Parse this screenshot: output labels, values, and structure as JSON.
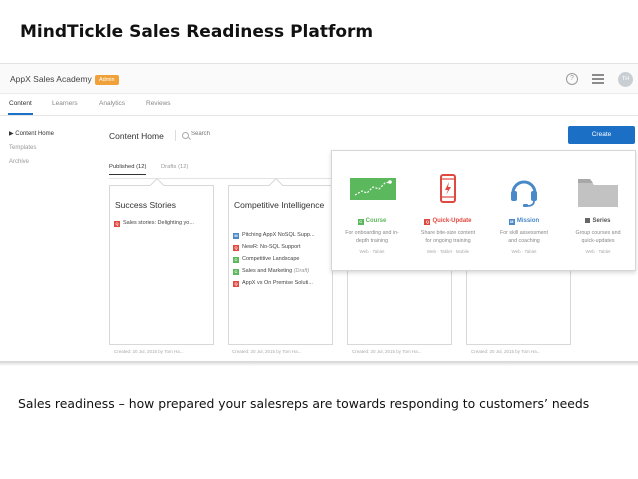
{
  "slide": {
    "title": "MindTickle Sales Readiness Platform",
    "caption": "Sales readiness – how prepared your salesreps are towards responding to customers’ needs"
  },
  "app": {
    "title": "AppX Sales Academy",
    "badge": "Admin",
    "avatar_initials": "TH",
    "icons": {
      "help": "help-circle-icon",
      "menu": "hamburger-menu-icon"
    }
  },
  "nav": {
    "tabs": [
      "Content",
      "Learners",
      "Analytics",
      "Reviews"
    ],
    "active": "Content"
  },
  "sidebar": {
    "items": [
      "▶ Content Home",
      "Templates",
      "Archive"
    ]
  },
  "main": {
    "heading": "Content Home",
    "search_placeholder": "Search",
    "create_label": "Create",
    "subtabs": [
      "Published (12)",
      "Drafts (12)"
    ]
  },
  "cards": [
    {
      "title": "Success Stories",
      "items": [
        {
          "type": "Q",
          "text": "Sales stories: Delighting yo..."
        }
      ],
      "created": "Created: 20 Jul, 2015 by Tom Ha..."
    },
    {
      "title": "Competitive Intelligence",
      "items": [
        {
          "type": "M",
          "text": "Pitching AppX NoSQL Supp..."
        },
        {
          "type": "Q",
          "text": "NewR: No-SQL Support"
        },
        {
          "type": "C",
          "text": "Competitive Landscape"
        },
        {
          "type": "C",
          "text": "Sales and Marketing",
          "suffix": "(Draft)"
        },
        {
          "type": "Q",
          "text": "AppX vs On Premise Soluti..."
        }
      ],
      "created": "Created: 20 Jul, 2015 by Tom Ha..."
    },
    {
      "title": "",
      "items": [],
      "created": "Created: 20 Jul, 2015 by Tom Ha..."
    },
    {
      "title": "",
      "items": [],
      "created": "Created: 20 Jul, 2015 by Tom Ha..."
    }
  ],
  "create_options": [
    {
      "name": "Course",
      "icon_letter": "C",
      "icon": "chart-progress-icon",
      "color": "#5cb85c",
      "desc_lines": [
        "For onboarding and in-",
        "depth training"
      ],
      "platforms": "Web · Tablet"
    },
    {
      "name": "Quick-Update",
      "icon_letter": "Q",
      "icon": "phone-alert-icon",
      "color": "#e0493f",
      "desc_lines": [
        "Share bite-size content",
        "for ongoing training"
      ],
      "platforms": "Web · Tablet · Mobile"
    },
    {
      "name": "Mission",
      "icon_letter": "M",
      "icon": "headset-icon",
      "color": "#4a89c8",
      "desc_lines": [
        "For skill assessment",
        "and coaching"
      ],
      "platforms": "Web · Tablet"
    },
    {
      "name": "Series",
      "icon_letter": "■",
      "icon": "folder-icon",
      "color": "#666666",
      "desc_lines": [
        "Group courses and",
        "quick-updates"
      ],
      "platforms": "Web · Tablet"
    }
  ],
  "item_type_colors": {
    "Q": "#e0493f",
    "M": "#4a89c8",
    "C": "#5cb85c"
  }
}
